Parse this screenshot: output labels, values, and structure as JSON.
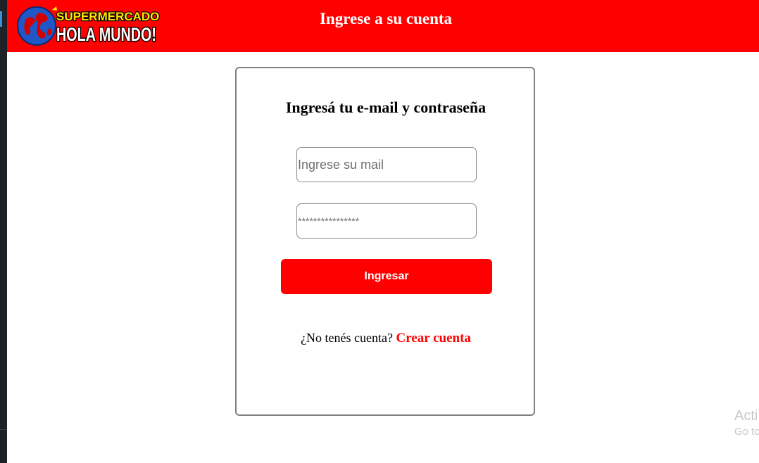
{
  "header": {
    "logo": {
      "line1": "SUPERMERCADO",
      "line2": "HOLA MUNDO!"
    },
    "title": "Ingrese a su cuenta"
  },
  "login_card": {
    "title": "Ingresá tu e-mail y contraseña",
    "email_placeholder": "Ingrese su mail",
    "password_placeholder": "****************",
    "submit_label": "Ingresar",
    "signup_prompt": "¿No tenés cuenta?",
    "signup_link": "Crear cuenta"
  },
  "watermark": {
    "line1": "Acti",
    "line2": "Go to"
  },
  "colors": {
    "brand_red": "#ff0000",
    "globe_blue": "#1f57c8",
    "logo_yellow": "#ffe800"
  },
  "icons": [
    "globe-icon"
  ]
}
